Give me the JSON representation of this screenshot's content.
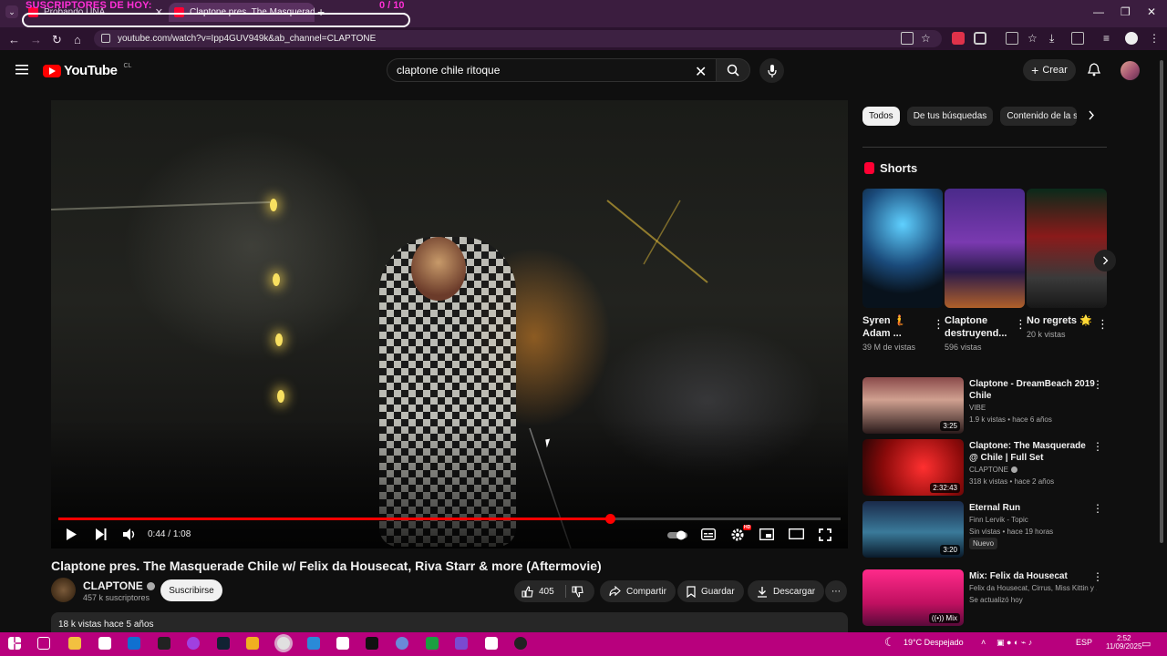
{
  "overlay": {
    "subs_title": "SUSCRIPTORES DE HOY:",
    "subs_count": "0  / 10"
  },
  "browser": {
    "tabs": [
      {
        "label": "Probando UNA..."
      },
      {
        "label": "Claptone pres. The Masquerade"
      }
    ],
    "url": "youtube.com/watch?v=Ipp4GUV949k&ab_channel=CLAPTONE",
    "new_tab": "+",
    "win_min": "—",
    "win_max": "❐",
    "win_close": "✕"
  },
  "header": {
    "logo_text": "YouTube",
    "country": "CL",
    "search_value": "claptone chile ritoque",
    "create_label": "Crear"
  },
  "player": {
    "time_current": "0:44",
    "time_sep": " / ",
    "time_total": "1:08",
    "progress": 0.705,
    "hd_badge": "HD"
  },
  "video": {
    "title": "Claptone pres. The Masquerade Chile w/ Felix da Housecat, Riva Starr & more (Aftermovie)",
    "channel": "CLAPTONE",
    "subscribers": "457 k suscriptores",
    "subscribe_label": "Suscribirse",
    "likes": "405",
    "share_label": "Compartir",
    "save_label": "Guardar",
    "download_label": "Descargar",
    "views_date": "18 k vistas  hace 5 años"
  },
  "sidebar": {
    "chips": [
      "Todos",
      "De tus búsquedas",
      "Contenido de la se"
    ],
    "shorts_title": "Shorts",
    "shorts": [
      {
        "title": "Syren 🧜 Adam ...",
        "views": "39 M de vistas"
      },
      {
        "title": "Claptone destruyend...",
        "views": "596 vistas"
      },
      {
        "title": "No regrets 🌟",
        "views": "20 k vistas"
      }
    ],
    "videos": [
      {
        "title": "Claptone - DreamBeach 2019 Chile",
        "channel": "VIBE",
        "meta": "1.9 k vistas • hace 6 años",
        "duration": "3:25"
      },
      {
        "title": "Claptone: The Masquerade @ Chile | Full Set",
        "channel": "CLAPTONE",
        "meta": "318 k vistas • hace 2 años",
        "duration": "2:32:43"
      },
      {
        "title": "Eternal Run",
        "channel": "Finn Lervik - Topic",
        "meta": "Sin vistas • hace 19 horas",
        "duration": "3:20",
        "badge": "Nuevo"
      },
      {
        "title": "Mix: Felix da Housecat",
        "channel": "Felix da Housecat, Cirrus, Miss Kittin y ...",
        "meta": "Se actualizó hoy",
        "duration": "Mix"
      }
    ]
  },
  "taskbar": {
    "weather": "19°C  Despejado",
    "lang": "ESP",
    "time": "2:52",
    "date": "11/09/2025"
  },
  "colors": {
    "accent": "#ff0000",
    "taskbar": "#b8007d",
    "chrome": "#3b1d3f"
  }
}
